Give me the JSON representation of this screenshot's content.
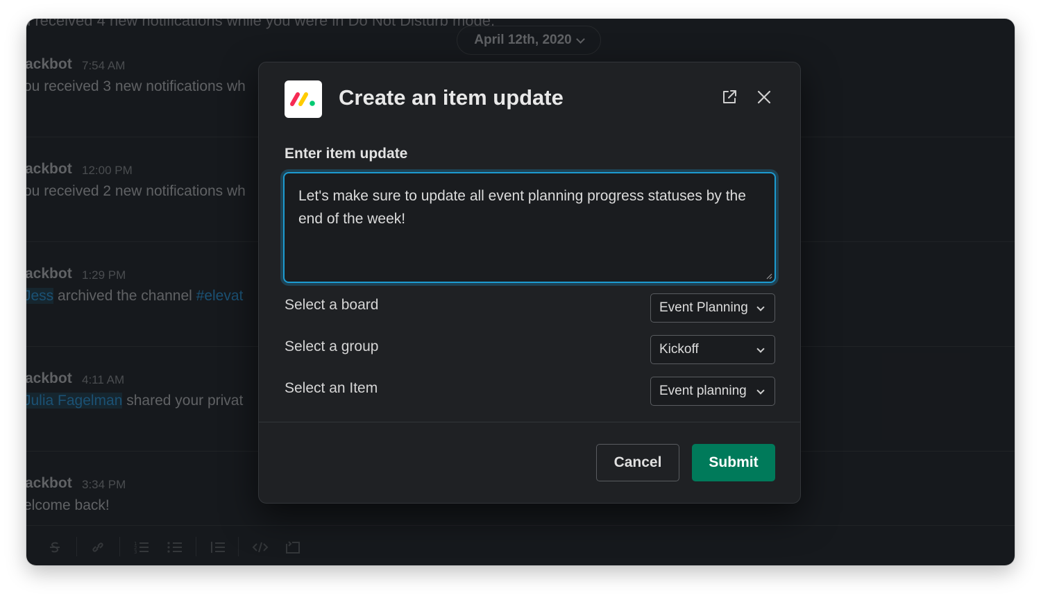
{
  "chat": {
    "dnd_notice": "u received 4 new notifications while you were in Do Not Disturb mode.",
    "date_label": "April 12th, 2020",
    "messages": [
      {
        "sender": "ackbot",
        "time": "7:54 AM",
        "text": "ou received 3 new notifications wh"
      },
      {
        "sender": "ackbot",
        "time": "12:00 PM",
        "text": "ou received 2 new notifications wh"
      },
      {
        "sender": "ackbot",
        "time": "1:29 PM",
        "mention": "Jess",
        "text": " archived the channel ",
        "channel": "#elevat"
      },
      {
        "sender": "ackbot",
        "time": "4:11 AM",
        "mention": "Julia Fagelman",
        "text": " shared your privat"
      },
      {
        "sender": "ackbot",
        "time": "3:34 PM",
        "text": "elcome back!"
      }
    ],
    "toolbar_icons": [
      "strikethrough-icon",
      "link-icon",
      "ordered-list-icon",
      "bulleted-list-icon",
      "blockquote-icon",
      "code-icon",
      "code-block-icon"
    ]
  },
  "modal": {
    "title": "Create an item update",
    "field_label": "Enter item update",
    "textarea_value": "Let's make sure to update all event planning progress statuses by the end of the week!",
    "rows": [
      {
        "label": "Select a board",
        "value": "Event Planning"
      },
      {
        "label": "Select a group",
        "value": "Kickoff"
      },
      {
        "label": "Select an Item",
        "value": "Event planning"
      }
    ],
    "cancel_label": "Cancel",
    "submit_label": "Submit"
  },
  "colors": {
    "accent_focus": "#1d9bd1",
    "submit_green": "#007a5a",
    "modal_bg": "#1f2124",
    "window_bg": "#1a1d21",
    "logo_red": "#f62b54",
    "logo_yellow": "#ffcc00",
    "logo_green": "#00ca72"
  }
}
